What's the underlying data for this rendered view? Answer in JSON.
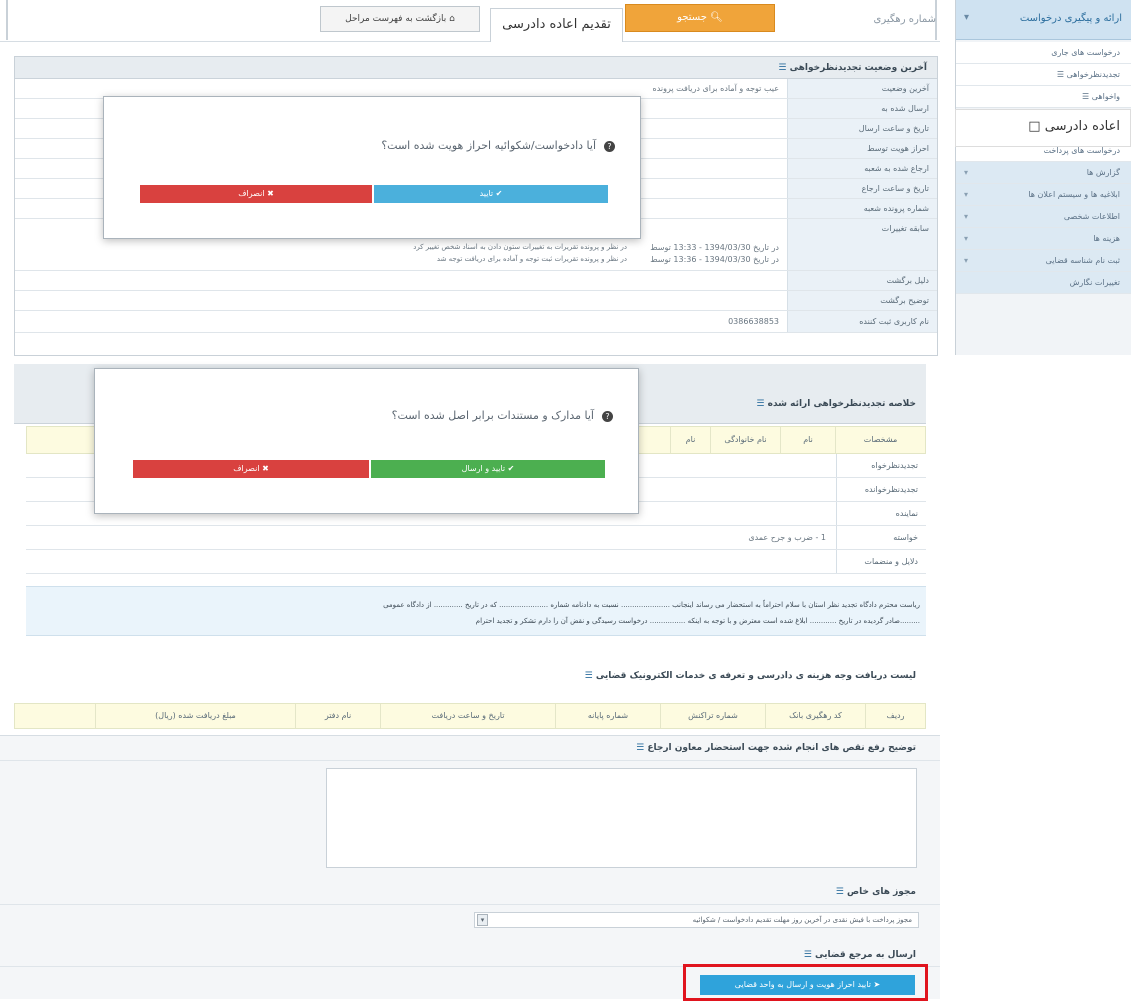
{
  "topbar": {
    "tracking_label": "شماره رهگیری",
    "search_button": "جستجو",
    "apply_tab": "تقدیم اعاده دادرسی",
    "back_button": "بازگشت به فهرست مراحل"
  },
  "sidebar": {
    "header": "ارائه و پیگیری درخواست",
    "items": [
      "درخواست های جاری",
      "تجدیدنظرخواهی",
      "واخواهی",
      "اعاده دادرسی",
      "درخواست های پرداخت",
      "گزارش ها",
      "ابلاغیه ها و سیستم اعلان ها",
      "اطلاعات شخصی",
      "هزینه ها",
      "ثبت نام شناسه قضایی",
      "تغییرات نگارش"
    ],
    "tooltip": "اعاده دادرسی"
  },
  "status_panel": {
    "title": "آخرین وضعیت تجدیدنظرخواهی",
    "rows": [
      {
        "label": "آخرین وضعیت",
        "value": "عیب توجه و آماده برای دریافت پرونده"
      },
      {
        "label": "ارسال شده به",
        "value": ""
      },
      {
        "label": "تاریخ و ساعت ارسال",
        "value": ""
      },
      {
        "label": "احراز هویت توسط",
        "value": ""
      },
      {
        "label": "ارجاع شده به شعبه",
        "value": ""
      },
      {
        "label": "تاریخ و ساعت ارجاع",
        "value": ""
      },
      {
        "label": "شماره پرونده شعبه",
        "value": ""
      },
      {
        "label": "سابقه تغییرات",
        "value": "در تاریخ 1394/03/30 - 13:33 توسط"
      },
      {
        "label": "",
        "value": "در تاریخ 1394/03/30 - 13:36 توسط"
      },
      {
        "label": "دلیل برگشت",
        "value": ""
      },
      {
        "label": "توضیح برگشت",
        "value": ""
      },
      {
        "label": "نام کاربری ثبت کننده",
        "value": "0386638853"
      }
    ],
    "history_note_1": "در نظر و پرونده تقریرات به تغییرات ستون دادن به اسناد شخص تغییر کرد",
    "history_note_2": "در نظر و پرونده تقریرات ثبت توجه و آماده برای دریافت توجه شد"
  },
  "modal1": {
    "question": "آیا دادخواست/شکوائیه احراز هویت شده است؟",
    "confirm": "تایید",
    "reject": "انصراف"
  },
  "summary_panel": {
    "title": "خلاصه تجدیدنظرخواهی ارائه شده",
    "headers": [
      "مشخصات",
      "نام",
      "نام خانوادگی",
      "نام"
    ],
    "rows": [
      "تجدیدنظرخواه",
      "تجدیدنظرخوانده",
      "نماینده",
      "خواسته",
      "دلایل و منضمات"
    ],
    "demand_value": "1 - ضرب و جرح عمدی",
    "notice_line1": "ریاست محترم دادگاه تجدید نظر استان با سلام احتراماً به استحضار می رساند اینجانب ...................... نسبت به دادنامه شماره ...................... که در تاریخ ............. از دادگاه عمومی",
    "notice_line2": ".........صادر گردیده در تاریخ ............ ابلاغ شده است معترض و با توجه به اینکه ................ درخواست رسیدگی و نقض آن را دارم تشکر و تجدید احترام"
  },
  "modal2": {
    "question": "آیا مدارک و مستندات برابر اصل شده است؟",
    "confirm": "تایید و ارسال",
    "reject": "انصراف"
  },
  "payments": {
    "title": "لیست دریافت وجه هزینه ی دادرسی و تعرفه ی خدمات الکترونیک قضایی",
    "headers": [
      "ردیف",
      "کد رهگیری بانک",
      "شماره تراکنش",
      "شماره پایانه",
      "تاریخ و ساعت دریافت",
      "نام دفتر",
      "مبلغ دریافت شده (ریال)"
    ]
  },
  "explanation": {
    "title": "توضیح رفع نقص های انجام شده جهت استحضار معاون ارجاع",
    "text": ""
  },
  "permits": {
    "title": "مجوز های خاص",
    "selected": "مجوز پرداخت با فیش نقدی در آخرین روز مهلت تقدیم دادخواست / شکوائیه"
  },
  "send": {
    "title": "ارسال به مرجع قضایی",
    "button": "تایید احراز هویت و ارسال به واحد قضایی"
  },
  "colors": {
    "accent": "#2fa3db",
    "orange": "#f0a43a",
    "red": "#d9413f",
    "green": "#4caf50",
    "highlight": "#e0141e"
  }
}
